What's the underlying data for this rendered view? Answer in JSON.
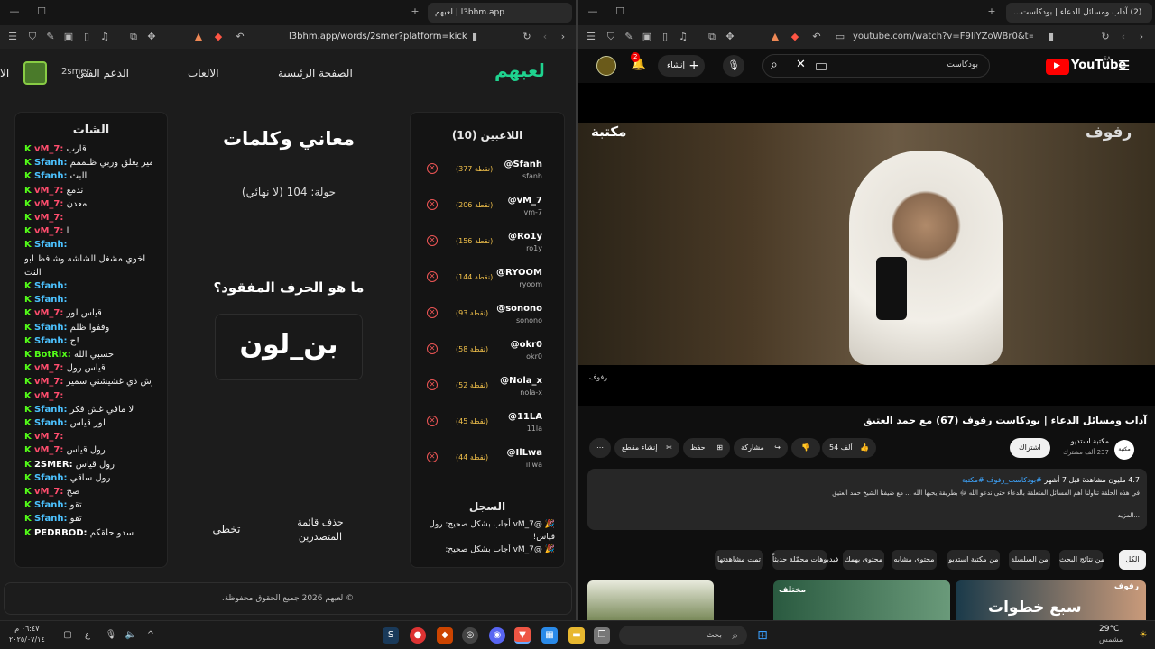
{
  "left_browser": {
    "tab_title": "l3bhm.app | لعبهم",
    "url": "l3bhm.app/words/2smer?platform=kick",
    "site": {
      "logo": "لعبهم",
      "nav": {
        "home": "الصفحة الرئيسية",
        "games": "الالعاب",
        "support": "الدعم الفني",
        "user": "2smer",
        "extra": "الا"
      },
      "game_title": "معاني وكلمات",
      "round": "جولة: 104 (لا نهائي)",
      "question": "ما هو الحرف المفقود؟",
      "puzzle": "بن_لون",
      "buttons": {
        "skip": "تخطي",
        "remove_leaderboard": "حذف قائمة المتصدرين"
      },
      "footer": "© لعبهم 2026 جميع الحقوق محفوظة.",
      "players_title": "اللاعبين (10)",
      "players": [
        {
          "name": "@Sfanh",
          "sub": "sfanh",
          "points": "(377 نقطة)"
        },
        {
          "name": "@vM_7",
          "sub": "vm-7",
          "points": "(206 نقطة)"
        },
        {
          "name": "@Ro1y",
          "sub": "ro1y",
          "points": "(156 نقطة)"
        },
        {
          "name": "@RYOOM",
          "sub": "ryoom",
          "points": "(144 نقطة)"
        },
        {
          "name": "@sonono",
          "sub": "sonono",
          "points": "(93 نقطة)"
        },
        {
          "name": "@okr0",
          "sub": "okr0",
          "points": "(58 نقطة)"
        },
        {
          "name": "@Nola_x",
          "sub": "nola-x",
          "points": "(52 نقطة)"
        },
        {
          "name": "@11LA",
          "sub": "11la",
          "points": "(45 نقطة)"
        },
        {
          "name": "@IlLwa",
          "sub": "illwa",
          "points": "(44 نقطة)"
        }
      ],
      "log_title": "السجل",
      "log": [
        "🎉 @vM_7 أجاب بشكل صحيح: رول قياس!",
        "🎉 @vM_7 أجاب بشكل صحيح:"
      ],
      "chat_title": "الشات",
      "chat": [
        {
          "user": "vM_7:",
          "msg": "قارب",
          "color": "#ff4d6d"
        },
        {
          "user": "Sfanh:",
          "msg": "سمير يعلق وربي ظلممم",
          "color": "#4cc2ff"
        },
        {
          "user": "Sfanh:",
          "msg": "البث",
          "color": "#4cc2ff"
        },
        {
          "user": "vM_7:",
          "msg": "ندمع",
          "color": "#ff4d6d"
        },
        {
          "user": "vM_7:",
          "msg": "معدن",
          "color": "#ff4d6d"
        },
        {
          "user": "vM_7:",
          "msg": "",
          "color": "#ff4d6d"
        },
        {
          "user": "vM_7:",
          "msg": "ا",
          "color": "#ff4d6d"
        },
        {
          "user": "Sfanh:",
          "msg": "",
          "color": "#4cc2ff"
        },
        {
          "user": "",
          "msg": "اخوي مشغل الشاشه وشافظ ابو",
          "color": "#4cc2ff"
        },
        {
          "user": "",
          "msg": "النت",
          "color": "#4cc2ff"
        },
        {
          "user": "Sfanh:",
          "msg": "",
          "color": "#4cc2ff"
        },
        {
          "user": "Sfanh:",
          "msg": "",
          "color": "#4cc2ff"
        },
        {
          "user": "vM_7:",
          "msg": "قياس لور",
          "color": "#ff4d6d"
        },
        {
          "user": "Sfanh:",
          "msg": "وقفوا ظلم",
          "color": "#4cc2ff"
        },
        {
          "user": "Sfanh:",
          "msg": "ح!",
          "color": "#4cc2ff"
        },
        {
          "user": "BotRix:",
          "msg": "حسبي الله",
          "color": "#53fc18"
        },
        {
          "user": "vM_7:",
          "msg": "قياس رول",
          "color": "#ff4d6d"
        },
        {
          "user": "vM_7:",
          "msg": "وش ذي غشيشني سمير",
          "color": "#ff4d6d"
        },
        {
          "user": "vM_7:",
          "msg": "",
          "color": "#ff4d6d"
        },
        {
          "user": "Sfanh:",
          "msg": "لا مافي غش فكر",
          "color": "#4cc2ff"
        },
        {
          "user": "Sfanh:",
          "msg": "لور قياس",
          "color": "#4cc2ff"
        },
        {
          "user": "vM_7:",
          "msg": "",
          "color": "#ff4d6d"
        },
        {
          "user": "vM_7:",
          "msg": "رول قياس",
          "color": "#ff4d6d"
        },
        {
          "user": "2SMER:",
          "msg": "رول قياس",
          "color": "#ffffff"
        },
        {
          "user": "Sfanh:",
          "msg": "رول ساقي",
          "color": "#4cc2ff"
        },
        {
          "user": "vM_7:",
          "msg": "صح",
          "color": "#ff4d6d"
        },
        {
          "user": "Sfanh:",
          "msg": "تقو",
          "color": "#4cc2ff"
        },
        {
          "user": "Sfanh:",
          "msg": "تقو",
          "color": "#4cc2ff"
        },
        {
          "user": "PEDRBOD:",
          "msg": "سدو حلقكم",
          "color": "#ffffff"
        }
      ]
    }
  },
  "right_browser": {
    "tab_title": "(2) آداب ومسائل الدعاء | بودكاست...",
    "url": "youtube.com/watch?v=F9IiYZoWBr0&t=1...",
    "youtube": {
      "logo": "YouTube",
      "region": "SA",
      "search_value": "بودكاست",
      "create_label": "إنشاء",
      "notif_count": "2",
      "video_watermark": "رفوف",
      "video_brand": "مكتبة",
      "video_caption": "رفوف",
      "title": "آداب ومسائل الدعاء | بودكاست رفوف (67) مع حمد العتيق",
      "channel": "مكتبة استديو",
      "subs": "237 ألف مشترك",
      "subscribe": "اشتراك",
      "likes": "54 ألف",
      "share": "مشاركة",
      "save": "حفظ",
      "clip": "إنشاء مقطع",
      "views": "4.7 مليون مشاهدة قبل 7 أشهر",
      "desc_tags": "#بودكاست_رفوف #مكتبة",
      "desc_text": "في هذه الحلقة تناولنا أهم المسائل المتعلقة بالدعاء حتى ندعو الله ﷻ بطريقة يحبها الله ... مع ضيفنا الشيخ حمد العتيق",
      "more": "...المزيد",
      "chips": [
        "الكل",
        "من نتائج البحث",
        "من السلسلة",
        "من مكتبة استديو",
        "محتوى مشابه",
        "محتوى يهمك",
        "فيديوهات محمّلة حديثاً",
        "تمت مشاهدتها"
      ],
      "thumb_texts": [
        "رفوف",
        "مختلف",
        "سبع خطوات"
      ]
    }
  },
  "taskbar": {
    "search_placeholder": "بحث",
    "time": "٠٦:٤٧ م",
    "date": "٢٠٢٥/٠٧/١٤",
    "temp": "29°C",
    "weather": "مشمس",
    "lang": "ع"
  }
}
